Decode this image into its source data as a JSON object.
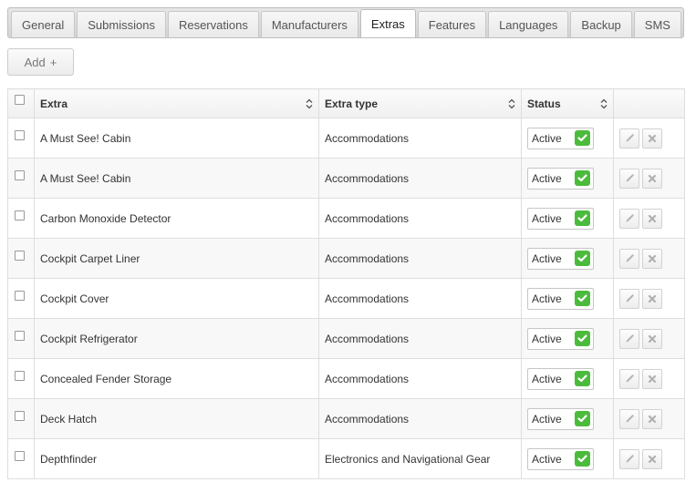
{
  "tabs": [
    {
      "label": "General",
      "active": false
    },
    {
      "label": "Submissions",
      "active": false
    },
    {
      "label": "Reservations",
      "active": false
    },
    {
      "label": "Manufacturers",
      "active": false
    },
    {
      "label": "Extras",
      "active": true
    },
    {
      "label": "Features",
      "active": false
    },
    {
      "label": "Languages",
      "active": false
    },
    {
      "label": "Backup",
      "active": false
    },
    {
      "label": "SMS",
      "active": false
    }
  ],
  "toolbar": {
    "add_label": "Add",
    "add_icon": "plus-icon"
  },
  "table": {
    "columns": {
      "extra": "Extra",
      "extra_type": "Extra type",
      "status": "Status"
    },
    "rows": [
      {
        "extra": "A Must See! Cabin",
        "type": "Accommodations",
        "status": "Active"
      },
      {
        "extra": "A Must See! Cabin",
        "type": "Accommodations",
        "status": "Active"
      },
      {
        "extra": "Carbon Monoxide Detector",
        "type": "Accommodations",
        "status": "Active"
      },
      {
        "extra": "Cockpit Carpet Liner",
        "type": "Accommodations",
        "status": "Active"
      },
      {
        "extra": "Cockpit Cover",
        "type": "Accommodations",
        "status": "Active"
      },
      {
        "extra": "Cockpit Refrigerator",
        "type": "Accommodations",
        "status": "Active"
      },
      {
        "extra": "Concealed Fender Storage",
        "type": "Accommodations",
        "status": "Active"
      },
      {
        "extra": "Deck Hatch",
        "type": "Accommodations",
        "status": "Active"
      },
      {
        "extra": "Depthfinder",
        "type": "Electronics and Navigational Gear",
        "status": "Active"
      }
    ]
  },
  "colors": {
    "active_check": "#4cbb3d",
    "tabbar_bg": "#d9d9d9",
    "border": "#dedede"
  }
}
